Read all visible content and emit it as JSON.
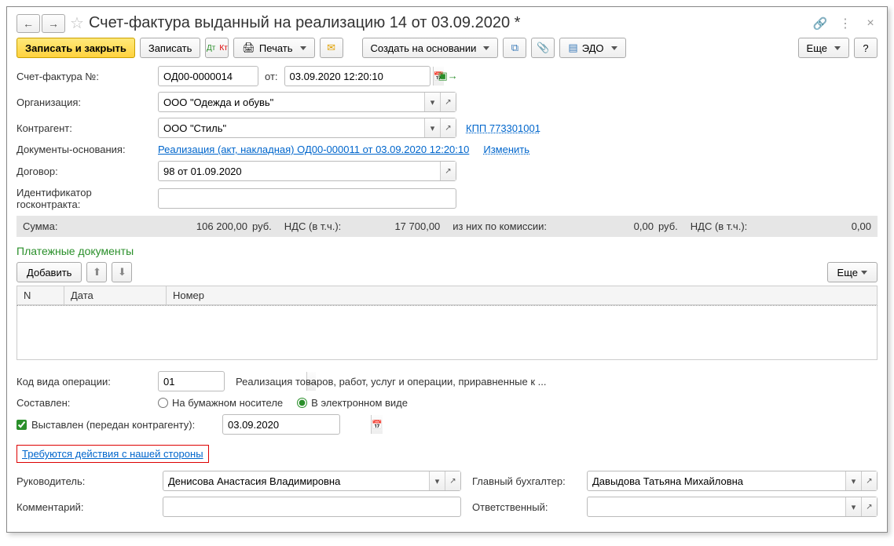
{
  "title": "Счет-фактура выданный на реализацию 14 от 03.09.2020 *",
  "toolbar": {
    "save_close": "Записать и закрыть",
    "save": "Записать",
    "print": "Печать",
    "create_based": "Создать на основании",
    "edo": "ЭДО",
    "more": "Еще",
    "help": "?"
  },
  "labels": {
    "invoice_no": "Счет-фактура №:",
    "from": "от:",
    "org": "Организация:",
    "counterparty": "Контрагент:",
    "basis": "Документы-основания:",
    "contract": "Договор:",
    "gov_id": "Идентификатор госконтракта:",
    "sum": "Сумма:",
    "rub": "руб.",
    "vat": "НДС (в т.ч.):",
    "commission": "из них по комиссии:",
    "vat2": "НДС (в т.ч.):",
    "section_payments": "Платежные документы",
    "add": "Добавить",
    "col_n": "N",
    "col_date": "Дата",
    "col_number": "Номер",
    "op_code": "Код вида операции:",
    "composed": "Составлен:",
    "paper": "На бумажном носителе",
    "electronic": "В электронном виде",
    "issued": "Выставлен (передан контрагенту):",
    "highlight": "Требуются действия с нашей стороны",
    "director": "Руководитель:",
    "accountant": "Главный бухгалтер:",
    "comment": "Комментарий:",
    "responsible": "Ответственный:",
    "change": "Изменить"
  },
  "values": {
    "invoice_no": "ОД00-0000014",
    "datetime": "03.09.2020 12:20:10",
    "org": "ООО \"Одежда и обувь\"",
    "counterparty": "ООО \"Стиль\"",
    "kpp": "КПП 773301001",
    "basis_link": "Реализация (акт, накладная) ОД00-000011 от 03.09.2020 12:20:10",
    "contract": "98 от 01.09.2020",
    "gov_id": "",
    "sum": "106 200,00",
    "vat": "17 700,00",
    "commission": "0,00",
    "vat2": "0,00",
    "op_code": "01",
    "op_desc": "Реализация товаров, работ, услуг и операции, приравненные к ...",
    "issued_date": "03.09.2020",
    "director": "Денисова Анастасия Владимировна",
    "accountant": "Давыдова Татьяна Михайловна",
    "comment": "",
    "responsible": ""
  }
}
